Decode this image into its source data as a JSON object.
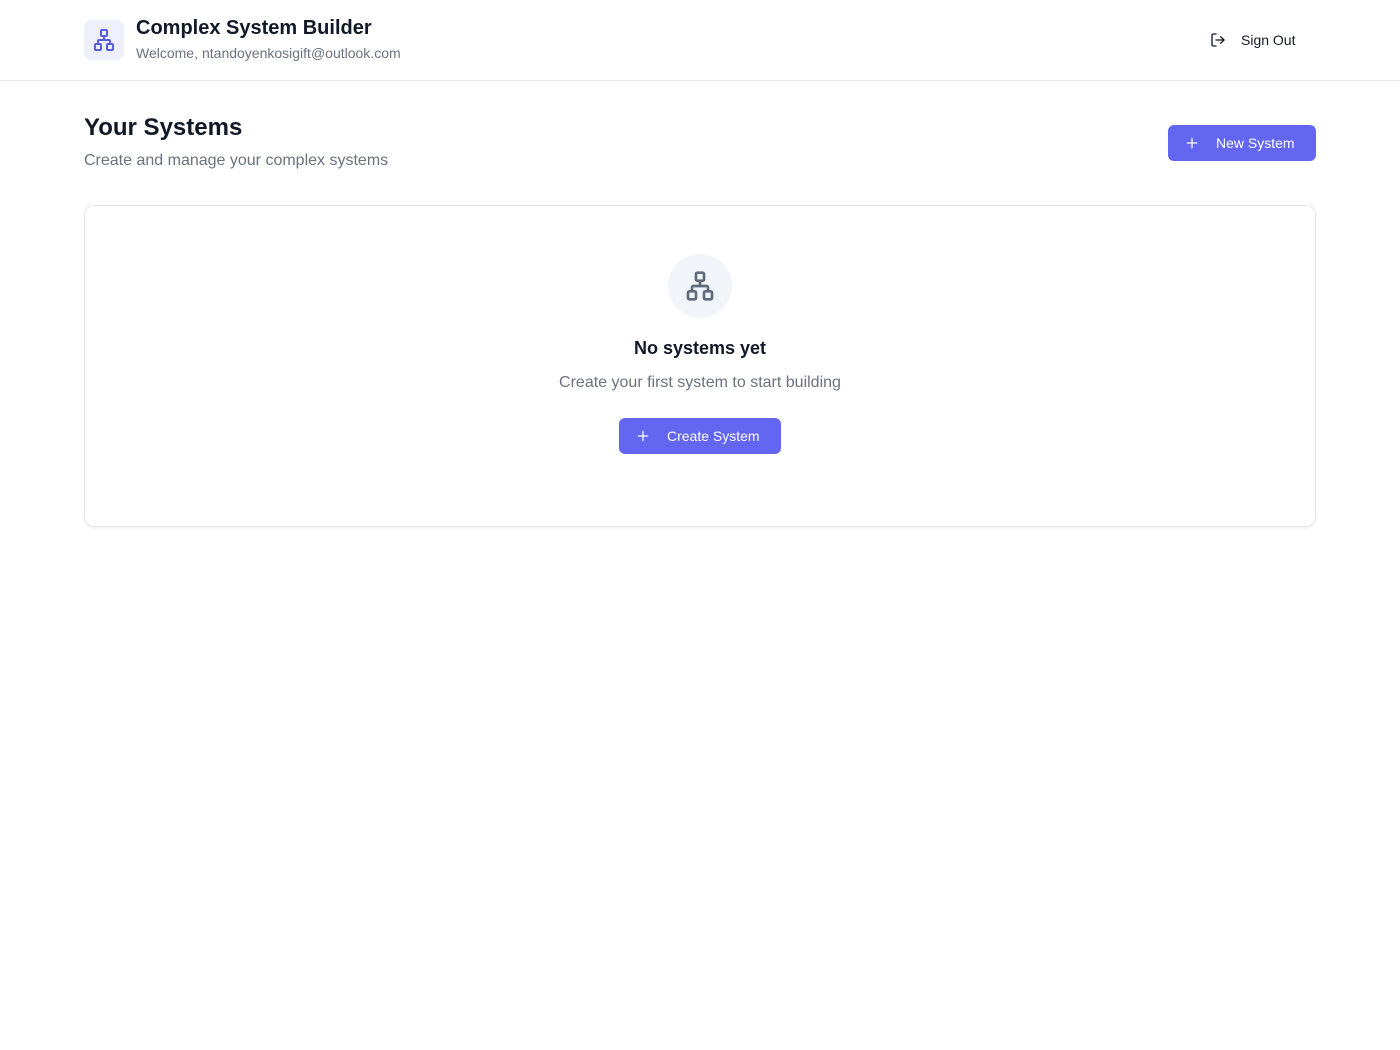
{
  "header": {
    "app_title": "Complex System Builder",
    "welcome_prefix": "Welcome,",
    "user_email": "ntandoyenkosigift@outlook.com",
    "sign_out_label": "Sign Out",
    "logo_icon": "network-icon",
    "sign_out_icon": "log-out-icon"
  },
  "main": {
    "title": "Your Systems",
    "subtitle": "Create and manage your complex systems",
    "new_system_label": "New System",
    "new_system_icon": "plus-icon"
  },
  "empty_state": {
    "icon": "network-icon",
    "title": "No systems yet",
    "description": "Create your first system to start building",
    "create_label": "Create System",
    "create_icon": "plus-icon"
  },
  "colors": {
    "accent": "#6366f1",
    "logo_bg": "#eef0fb",
    "muted_text": "#6b7280",
    "border": "#e5e7eb"
  }
}
